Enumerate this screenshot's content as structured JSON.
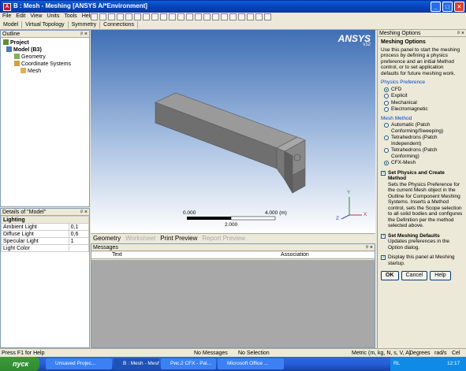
{
  "window": {
    "app_icon": "A",
    "title": "B : Mesh - Meshing [ANSYS A/*Environment]",
    "min_glyph": "_",
    "max_glyph": "□",
    "close_glyph": "×"
  },
  "menu": {
    "items": [
      "File",
      "Edit",
      "View",
      "Units",
      "Tools",
      "Help"
    ]
  },
  "toolbar2": {
    "items": [
      "Model",
      "Virtual Topology",
      "Symmetry",
      "Connections"
    ]
  },
  "outline": {
    "header": "Outline",
    "pin": "ᵖ ×",
    "items": [
      {
        "label": "Project",
        "indent": 0
      },
      {
        "label": "Model (B3)",
        "indent": 1
      },
      {
        "label": "Geometry",
        "indent": 2
      },
      {
        "label": "Coordinate Systems",
        "indent": 2
      },
      {
        "label": "Mesh",
        "indent": 2
      }
    ]
  },
  "details": {
    "header": "Details of \"Model\"",
    "pin": "ᵖ ×",
    "group": "Lighting",
    "rows": [
      {
        "name": "Ambient Light",
        "value": "0,1"
      },
      {
        "name": "Diffuse Light",
        "value": "0,6"
      },
      {
        "name": "Specular Light",
        "value": "1"
      },
      {
        "name": "Light Color",
        "value": ""
      }
    ]
  },
  "viewport": {
    "logo": "ANSYS",
    "version": "v12",
    "scale_left": "0.000",
    "scale_right": "4.000 (m)",
    "scale_mid": "2.000",
    "axis_x": "X",
    "axis_y": "Y",
    "axis_z": "Z"
  },
  "view_tabs": {
    "items": [
      {
        "label": "Geometry",
        "active": true
      },
      {
        "label": "Worksheet",
        "active": false
      },
      {
        "label": "Print Preview",
        "active": true
      },
      {
        "label": "Report Preview",
        "active": false
      }
    ]
  },
  "messages": {
    "header": "Messages",
    "pin": "ᵖ ×",
    "columns": [
      "Text",
      "Association"
    ]
  },
  "meshing_options": {
    "header": "Meshing Options",
    "pin": "ᵖ ×",
    "title": "Meshing Options",
    "intro": "Use this panel to start the meshing process by defining a physics preference and an initial Method control, or to set application defaults for future meshing work.",
    "physics_title": "Physics Preference",
    "physics_options": [
      {
        "label": "CFD",
        "selected": true
      },
      {
        "label": "Explicit",
        "selected": false
      },
      {
        "label": "Mechanical",
        "selected": false
      },
      {
        "label": "Electromagnetic",
        "selected": false
      }
    ],
    "method_title": "Mesh Method",
    "method_options": [
      {
        "label": "Automatic (Patch Conforming/Sweeping)",
        "selected": false
      },
      {
        "label": "Tetrahedrons (Patch Independent)",
        "selected": false
      },
      {
        "label": "Tetrahedrons (Patch Conforming)",
        "selected": false
      },
      {
        "label": "CFX-Mesh",
        "selected": true
      }
    ],
    "set_physics_label": "Set Physics and Create Method",
    "set_physics_desc": "Sets the Physics Preference for the current Mesh object in the Outline for Component Meshing Systems. Inserts a Method control, sets the Scope selection to all solid bodies and configures the Definition per the method selected above.",
    "set_defaults_label": "Set Meshing Defaults",
    "set_defaults_desc": "Updates preferences in the Option dialog.",
    "display_startup_label": "Display this panel at Meshing startup.",
    "ok": "OK",
    "cancel": "Cancel",
    "help": "Help"
  },
  "status": {
    "help": "Press F1 for Help",
    "messages": "No Messages",
    "selection": "No Selection",
    "units": "Metric (m, kg, N, s, V, A)",
    "angle": "Degrees",
    "rate": "rad/s",
    "temp": "Cel"
  },
  "taskbar": {
    "start": "пуск",
    "tasks": [
      {
        "label": "Unsaved Projec...",
        "active": false
      },
      {
        "label": "B : Mesh - Meshi...",
        "active": true
      },
      {
        "label": "Рис.2 CFX - Pai...",
        "active": false
      },
      {
        "label": "Microsoft Office ...",
        "active": false
      }
    ],
    "lang": "RL",
    "clock": "12:17"
  },
  "colors": {
    "viewport_top": "#3f6fb5",
    "body_face": "#7b7b7b",
    "accent_blue": "#0046d5"
  }
}
